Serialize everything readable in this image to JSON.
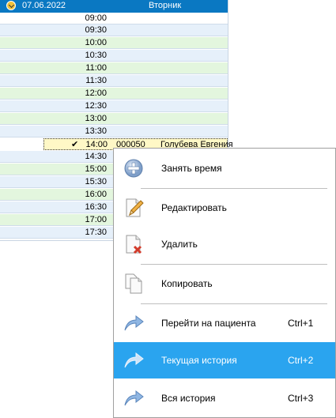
{
  "schedule": {
    "date": "07.06.2022",
    "weekday": "Вторник",
    "slots": [
      "09:00",
      "09:30",
      "10:00",
      "10:30",
      "11:00",
      "11:30",
      "12:00",
      "12:30",
      "13:00",
      "13:30",
      "14:00",
      "14:30",
      "15:00",
      "15:30",
      "16:00",
      "16:30",
      "17:00",
      "17:30"
    ],
    "booked": {
      "time": "14:00",
      "code": "000050",
      "patient": "Голубева Евгения"
    }
  },
  "context_menu": {
    "items": [
      {
        "label": "Занять время",
        "shortcut": "",
        "icon": "plus-circle-icon"
      },
      {
        "label": "Редактировать",
        "shortcut": "",
        "icon": "edit-document-icon"
      },
      {
        "label": "Удалить",
        "shortcut": "",
        "icon": "delete-document-icon"
      },
      {
        "label": "Копировать",
        "shortcut": "",
        "icon": "copy-documents-icon"
      },
      {
        "label": "Перейти на пациента",
        "shortcut": "Ctrl+1",
        "icon": "arrow-forward-icon"
      },
      {
        "label": "Текущая история",
        "shortcut": "Ctrl+2",
        "icon": "arrow-forward-icon"
      },
      {
        "label": "Вся история",
        "shortcut": "Ctrl+3",
        "icon": "arrow-forward-icon"
      }
    ],
    "highlighted": "Текущая история"
  },
  "colors": {
    "header": "#0a78c2",
    "highlight": "#2aa4ef",
    "booked_row": "#fff8c6"
  }
}
